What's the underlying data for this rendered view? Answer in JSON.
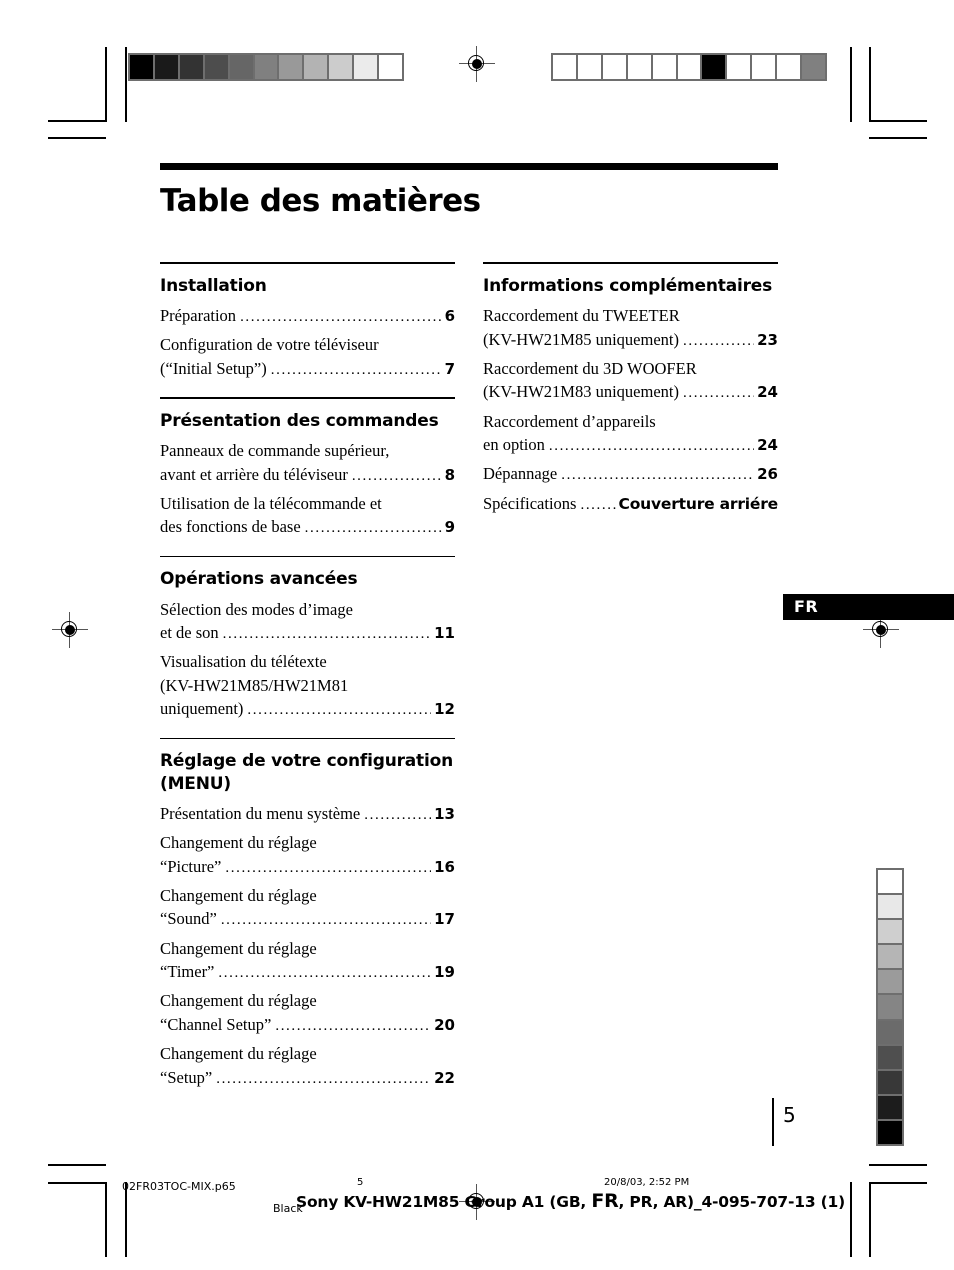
{
  "document": {
    "page_title": "Table des matières",
    "page_number": "5",
    "language_tab": "FR"
  },
  "columns": [
    {
      "id": "left",
      "sections": [
        {
          "heading": "Installation",
          "entries": [
            {
              "text": "Préparation",
              "page": "6",
              "multiline": false
            },
            {
              "text": "Configuration de votre téléviseur",
              "text2": "(“Initial Setup”)",
              "page": "7",
              "multiline": true
            }
          ]
        },
        {
          "heading": "Présentation des commandes",
          "entries": [
            {
              "text": "Panneaux de commande supérieur,",
              "text2": "avant et arrière du téléviseur",
              "page": "8",
              "multiline": true
            },
            {
              "text": "Utilisation de la télécommande et",
              "text2": "des fonctions de base",
              "page": "9",
              "multiline": true
            }
          ]
        },
        {
          "heading": "Opérations avancées",
          "entries": [
            {
              "text": "Sélection des modes d’image",
              "text2": "et de son",
              "page": "11",
              "multiline": true
            },
            {
              "text": "Visualisation du télétexte",
              "text2": "(KV-HW21M85/HW21M81",
              "text3": "uniquement)",
              "page": "12",
              "multiline": true
            }
          ]
        },
        {
          "heading": "Réglage de votre configuration (MENU)",
          "entries": [
            {
              "text": "Présentation du menu système",
              "page": "13",
              "multiline": false
            },
            {
              "text": "Changement du réglage",
              "text2": "“Picture”",
              "page": "16",
              "multiline": true
            },
            {
              "text": "Changement du réglage",
              "text2": "“Sound”",
              "page": "17",
              "multiline": true
            },
            {
              "text": "Changement du réglage",
              "text2": "“Timer”",
              "page": "19",
              "multiline": true
            },
            {
              "text": "Changement du réglage",
              "text2": "“Channel Setup”",
              "page": "20",
              "multiline": true
            },
            {
              "text": "Changement du réglage",
              "text2": "“Setup”",
              "page": "22",
              "multiline": true
            }
          ]
        }
      ]
    },
    {
      "id": "right",
      "sections": [
        {
          "heading": "Informations complémentaires",
          "entries": [
            {
              "text": "Raccordement du TWEETER",
              "text2": "(KV-HW21M85 uniquement)",
              "page": "23",
              "multiline": true
            },
            {
              "text": "Raccordement du 3D WOOFER",
              "text2": "(KV-HW21M83 uniquement)",
              "page": "24",
              "multiline": true
            },
            {
              "text": "Raccordement d’appareils",
              "text2": "en option",
              "page": "24",
              "multiline": true
            },
            {
              "text": "Dépannage",
              "page": "26",
              "multiline": false
            },
            {
              "text": "Spécifications",
              "page": "Couverture arriére",
              "multiline": false,
              "page_wordy": true
            }
          ]
        }
      ]
    }
  ],
  "footer": {
    "filename": "02FR03TOC-MIX.p65",
    "small_number": "5",
    "black_label": "Black",
    "date": "20/8/03, 2:52 PM",
    "title_pre": "Sony KV-HW21M85 Group A1 (GB, ",
    "title_fr": "FR",
    "title_post": ", PR, AR)_4-095-707-13 (1)"
  },
  "print_marks": {
    "gradient_bar_top_left": [
      "#000000",
      "#1a1a1a",
      "#333333",
      "#4d4d4d",
      "#666666",
      "#808080",
      "#999999",
      "#b3b3b3",
      "#cccccc",
      "#ebebeb",
      "#ffffff"
    ],
    "bar_top_right": [
      "#ffffff",
      "#ffffff",
      "#ffffff",
      "#ffffff",
      "#ffffff",
      "#ffffff",
      "#000000",
      "#ffffff",
      "#ffffff",
      "#ffffff",
      "#808080"
    ],
    "gradient_bar_right": [
      "#ffffff",
      "#e8e8e8",
      "#cfcfcf",
      "#b5b5b5",
      "#9b9b9b",
      "#858585",
      "#6b6b6b",
      "#4f4f4f",
      "#383838",
      "#1c1c1c",
      "#000000"
    ],
    "frame_color": "#6e6e6e"
  }
}
